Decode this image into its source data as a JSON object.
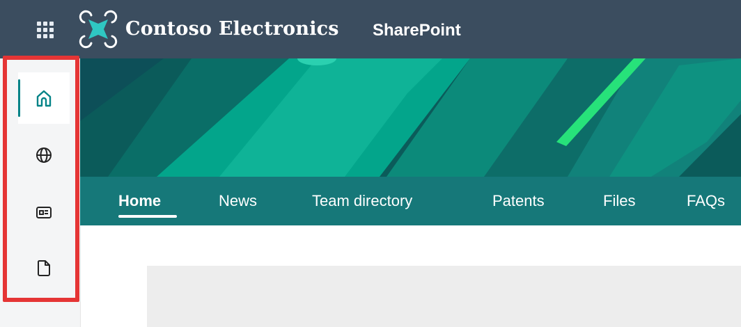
{
  "suitebar": {
    "app_launcher_icon": "waffle-icon",
    "brand": {
      "logo_icon": "contoso-drone-logo",
      "name": "Contoso Electronics"
    },
    "app_name": "SharePoint",
    "colors": {
      "background": "#3b4d5f",
      "text": "#ffffff"
    }
  },
  "appbar": {
    "items": [
      {
        "icon": "home-icon",
        "active": true
      },
      {
        "icon": "globe-icon",
        "active": false
      },
      {
        "icon": "news-icon",
        "active": false
      },
      {
        "icon": "file-icon",
        "active": false
      }
    ],
    "highlight_color": "#e53535",
    "active_indicator_color": "#038387"
  },
  "hero": {
    "colors": [
      "#0b5b5a",
      "#00a88e",
      "#17c1a3",
      "#22e07a"
    ]
  },
  "nav": {
    "items": [
      {
        "label": "Home",
        "active": true
      },
      {
        "label": "News",
        "active": false
      },
      {
        "label": "Team directory",
        "active": false
      },
      {
        "label": "Patents",
        "active": false
      },
      {
        "label": "Files",
        "active": false
      },
      {
        "label": "FAQs",
        "active": false
      }
    ],
    "background": "#167879"
  }
}
